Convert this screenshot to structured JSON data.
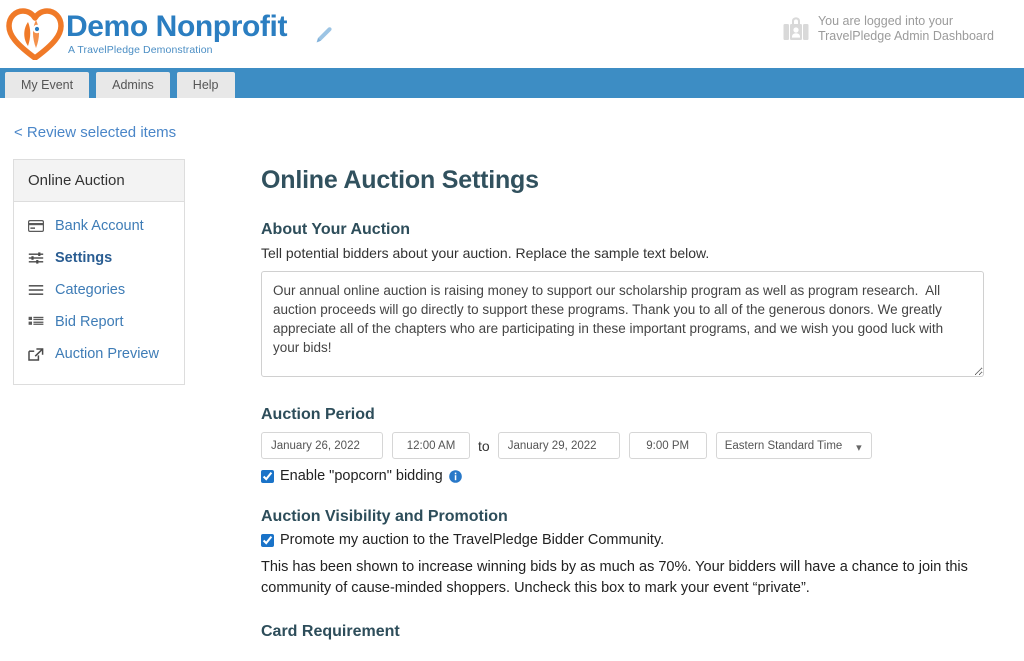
{
  "header": {
    "brand_title": "Demo Nonprofit",
    "brand_subtitle": "A TravelPledge Demonstration",
    "edit_icon": "pencil-icon",
    "login_icon": "briefcase-badge-icon",
    "login_line1": "You are logged into your",
    "login_line2": "TravelPledge Admin Dashboard"
  },
  "tabs": [
    {
      "label": "My Event"
    },
    {
      "label": "Admins"
    },
    {
      "label": "Help"
    }
  ],
  "back_link": "< Review selected items",
  "sidebar": {
    "title": "Online Auction",
    "items": [
      {
        "label": "Bank Account",
        "icon": "credit-card-icon",
        "active": false
      },
      {
        "label": "Settings",
        "icon": "sliders-icon",
        "active": true
      },
      {
        "label": "Categories",
        "icon": "list-bars-icon",
        "active": false
      },
      {
        "label": "Bid Report",
        "icon": "table-list-icon",
        "active": false
      },
      {
        "label": "Auction Preview",
        "icon": "external-link-icon",
        "active": false
      }
    ]
  },
  "main": {
    "page_title": "Online Auction Settings",
    "about": {
      "heading": "About Your Auction",
      "helper": "Tell potential bidders about your auction. Replace the sample text below.",
      "textarea_value": "Our annual online auction is raising money to support our scholarship program as well as program research.  All auction proceeds will go directly to support these programs. Thank you to all of the generous donors. We greatly appreciate all of the chapters who are participating in these important programs, and we wish you good luck with your bids!"
    },
    "period": {
      "heading": "Auction Period",
      "start_date": "January 26, 2022",
      "start_time": "12:00 AM",
      "to_label": "to",
      "end_date": "January 29, 2022",
      "end_time": "9:00 PM",
      "timezone": "Eastern Standard Time",
      "timezone_options": [
        "Eastern Standard Time"
      ],
      "popcorn_label": "Enable \"popcorn\" bidding",
      "popcorn_checked": true,
      "info_icon": "info-circle-icon"
    },
    "visibility": {
      "heading": "Auction Visibility and Promotion",
      "promote_label": "Promote my auction to the TravelPledge Bidder Community.",
      "promote_checked": true,
      "description": "This has been shown to increase winning bids by as much as 70%. Your bidders will have a chance to join this community of cause-minded shoppers. Uncheck this box to mark your event “private”."
    },
    "card_requirement": {
      "heading": "Card Requirement"
    }
  },
  "colors": {
    "brand_blue": "#2b7ec1",
    "tabbar_blue": "#3d8dc4",
    "link_blue": "#3e7cb6",
    "heading_slate": "#2d4d5a",
    "logo_orange": "#f07a28",
    "checkbox_blue": "#1a73c8"
  }
}
